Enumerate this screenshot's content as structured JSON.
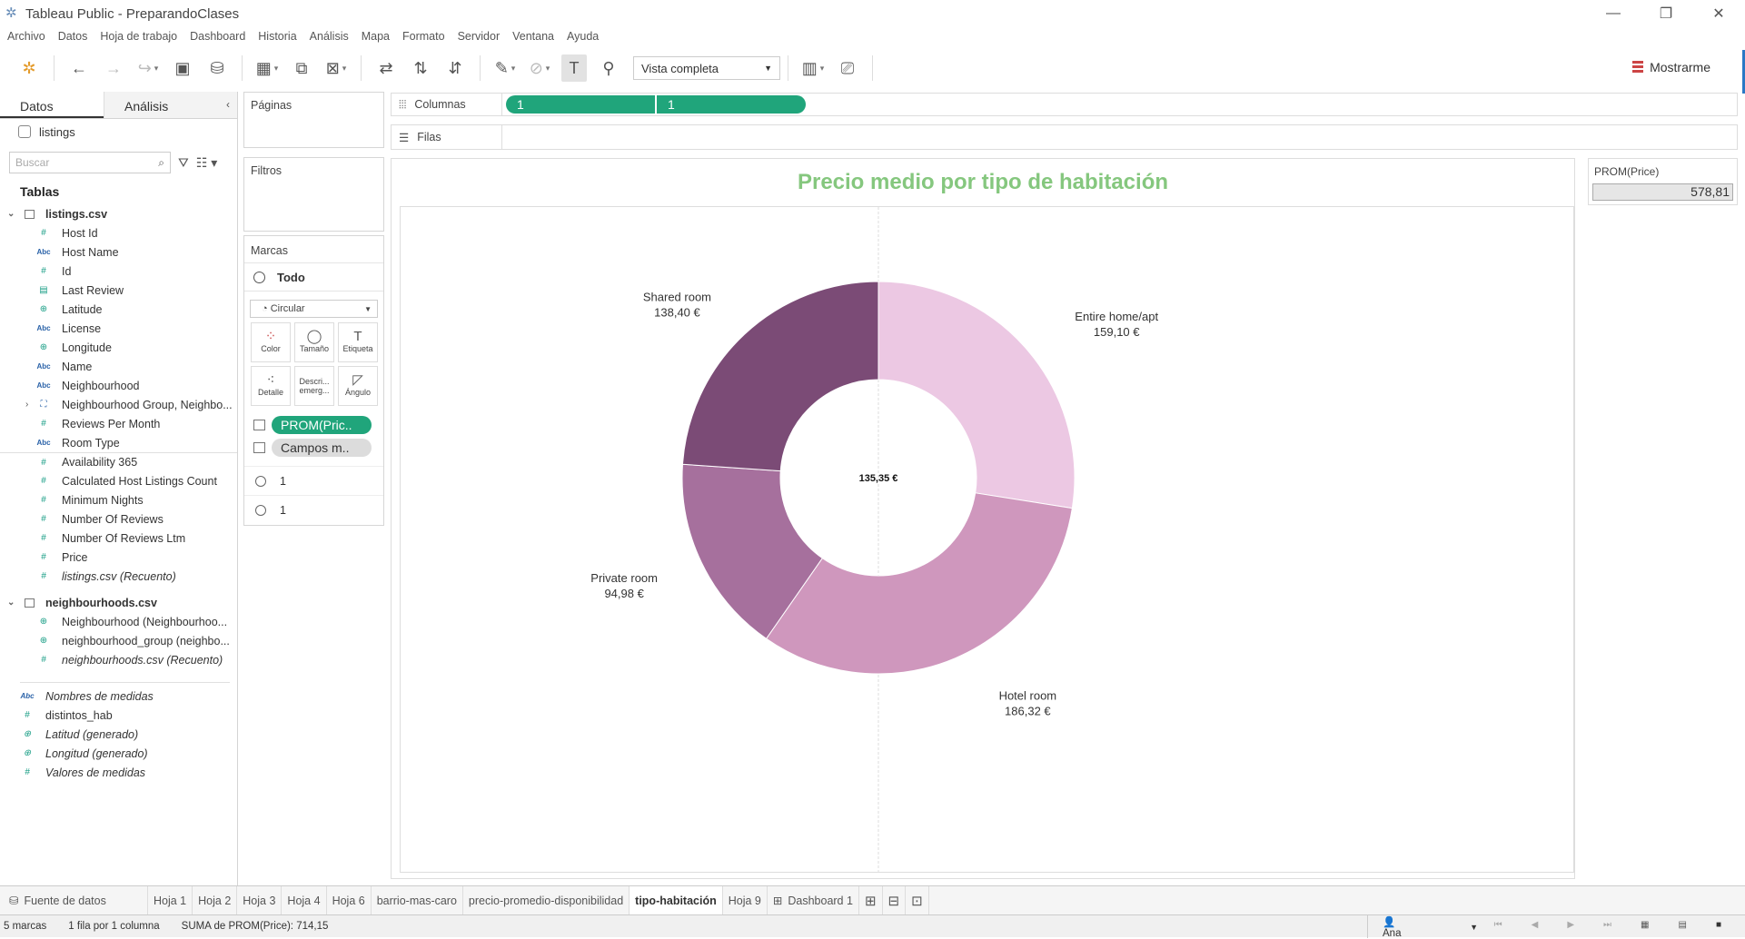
{
  "window": {
    "title": "Tableau Public - PreparandoClases"
  },
  "menu": [
    "Archivo",
    "Datos",
    "Hoja de trabajo",
    "Dashboard",
    "Historia",
    "Análisis",
    "Mapa",
    "Formato",
    "Servidor",
    "Ventana",
    "Ayuda"
  ],
  "toolbar": {
    "view_select": "Vista completa",
    "show_me": "Mostrarme"
  },
  "left": {
    "tab_data": "Datos",
    "tab_analysis": "Análisis",
    "source": "listings",
    "search_placeholder": "Buscar",
    "tables_heading": "Tablas",
    "tables": [
      {
        "name": "listings.csv",
        "fields": [
          {
            "icon": "#",
            "name": "Host Id"
          },
          {
            "icon": "Abc",
            "name": "Host Name"
          },
          {
            "icon": "#",
            "name": "Id"
          },
          {
            "icon": "cal",
            "name": "Last Review"
          },
          {
            "icon": "geo",
            "name": "Latitude"
          },
          {
            "icon": "Abc",
            "name": "License"
          },
          {
            "icon": "geo",
            "name": "Longitude"
          },
          {
            "icon": "Abc",
            "name": "Name"
          },
          {
            "icon": "Abc",
            "name": "Neighbourhood"
          },
          {
            "icon": "grp",
            "name": "Neighbourhood Group, Neighbo..."
          },
          {
            "icon": "#",
            "name": "Reviews Per Month"
          },
          {
            "icon": "Abc",
            "name": "Room Type"
          },
          {
            "icon": "#",
            "name": "Availability 365"
          },
          {
            "icon": "#",
            "name": "Calculated Host Listings Count"
          },
          {
            "icon": "#",
            "name": "Minimum Nights"
          },
          {
            "icon": "#",
            "name": "Number Of Reviews"
          },
          {
            "icon": "#",
            "name": "Number Of Reviews Ltm"
          },
          {
            "icon": "#",
            "name": "Price"
          },
          {
            "icon": "#",
            "name": "listings.csv (Recuento)"
          }
        ]
      },
      {
        "name": "neighbourhoods.csv",
        "fields": [
          {
            "icon": "geo",
            "name": "Neighbourhood (Neighbourhoo..."
          },
          {
            "icon": "geo",
            "name": "neighbourhood_group (neighbo..."
          },
          {
            "icon": "#",
            "name": "neighbourhoods.csv (Recuento)"
          }
        ]
      }
    ],
    "extra_fields": [
      {
        "icon": "Abc",
        "name": "Nombres de medidas"
      },
      {
        "icon": "#",
        "name": "distintos_hab"
      },
      {
        "icon": "geo",
        "name": "Latitud (generado)"
      },
      {
        "icon": "geo",
        "name": "Longitud (generado)"
      },
      {
        "icon": "#",
        "name": "Valores de medidas"
      }
    ]
  },
  "shelves": {
    "pages": "Páginas",
    "filters": "Filtros",
    "marks": "Marcas",
    "marks_all": "Todo",
    "mark_type": "Circular",
    "mark_buttons": [
      "Color",
      "Tamaño",
      "Etiqueta",
      "Detalle",
      "Descri... emerg...",
      "Ángulo"
    ],
    "mark_pills": [
      "PROM(Pric..",
      "Campos m.."
    ],
    "mark_layers": [
      "1",
      "1"
    ],
    "columns_label": "Columnas",
    "rows_label": "Filas",
    "column_pills": [
      "1",
      "1"
    ]
  },
  "chart_data": {
    "type": "pie",
    "title": "Precio medio por tipo de habitación",
    "center_label": "135,35 €",
    "categories": [
      "Entire home/apt",
      "Hotel room",
      "Private room",
      "Shared room"
    ],
    "values": [
      159.1,
      186.32,
      94.98,
      138.4
    ],
    "value_labels": [
      "159,10 €",
      "186,32 €",
      "94,98 €",
      "138,40 €"
    ],
    "colors": [
      "#ecc8e3",
      "#cf97bd",
      "#a6709d",
      "#7b4b76"
    ],
    "hole_ratio": 0.5
  },
  "legend": {
    "title": "PROM(Price)",
    "value": "578,81"
  },
  "sheets": [
    "Fuente de datos",
    "Hoja 1",
    "Hoja 2",
    "Hoja 3",
    "Hoja 4",
    "Hoja 6",
    "barrio-mas-caro",
    "precio-promedio-disponibilidad",
    "tipo-habitación",
    "Hoja 9",
    "Dashboard 1"
  ],
  "active_sheet": "tipo-habitación",
  "status": {
    "marks": "5 marcas",
    "rows": "1 fila por 1 columna",
    "sum": "SUMA de PROM(Price): 714,15",
    "user": "Ana"
  }
}
